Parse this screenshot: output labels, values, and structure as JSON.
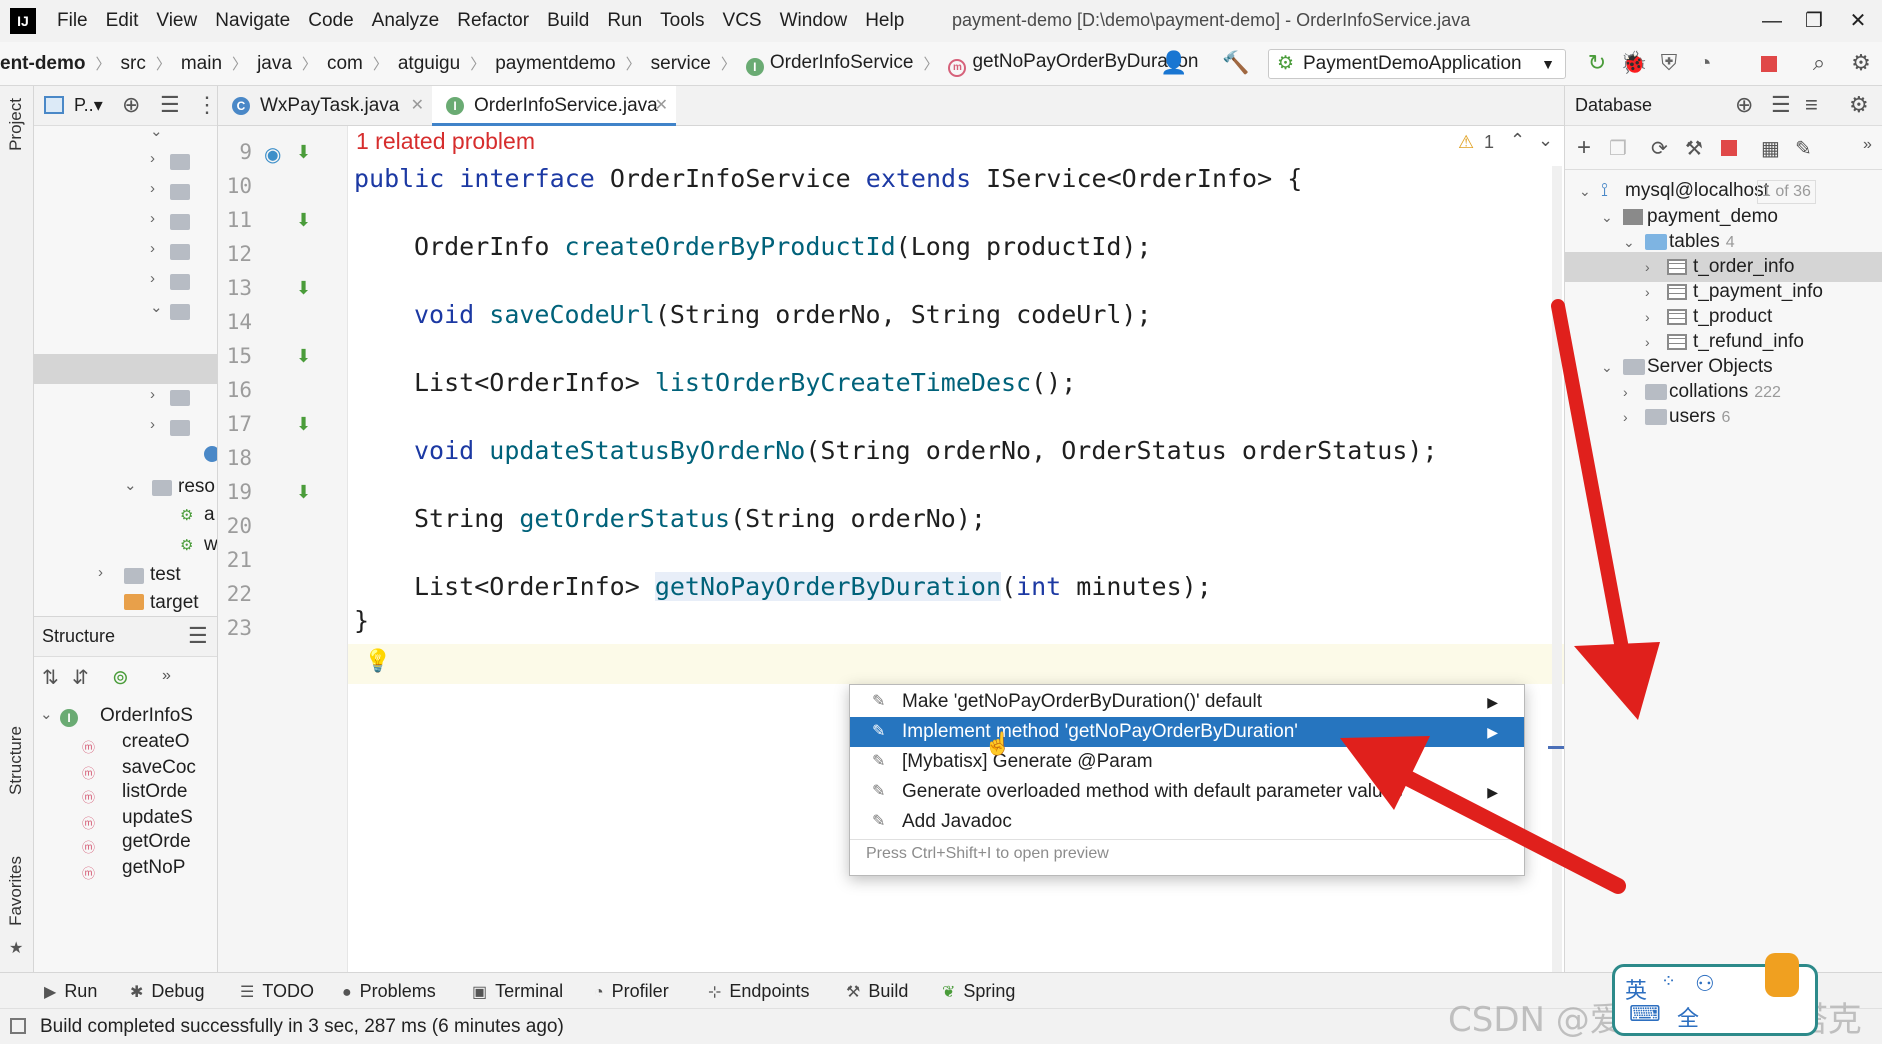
{
  "menubar": {
    "logo": "IJ",
    "items": [
      "File",
      "Edit",
      "View",
      "Navigate",
      "Code",
      "Analyze",
      "Refactor",
      "Build",
      "Run",
      "Tools",
      "VCS",
      "Window",
      "Help"
    ],
    "window_title": "payment-demo [D:\\demo\\payment-demo] - OrderInfoService.java"
  },
  "breadcrumbs": [
    "ent-demo",
    "src",
    "main",
    "java",
    "com",
    "atguigu",
    "paymentdemo",
    "service",
    "OrderInfoService",
    "getNoPayOrderByDuration"
  ],
  "run_config": "PaymentDemoApplication",
  "project_panel": {
    "tab_label": "P..▾",
    "items": [
      "reso",
      "a",
      "w",
      "test",
      "target"
    ]
  },
  "structure_panel": {
    "title": "Structure",
    "root": "OrderInfoS",
    "members": [
      "createO",
      "saveCoc",
      "listOrde",
      "updateS",
      "getOrde",
      "getNoP"
    ]
  },
  "left_strip": {
    "tabs": [
      "Project",
      "Structure",
      "Favorites"
    ]
  },
  "editor": {
    "tabs": [
      {
        "label": "WxPayTask.java",
        "active": false
      },
      {
        "label": "OrderInfoService.java",
        "active": true
      }
    ],
    "related_problem": "1 related problem",
    "warning_count": "1",
    "line_numbers": [
      "9",
      "10",
      "11",
      "12",
      "13",
      "14",
      "15",
      "16",
      "17",
      "18",
      "19",
      "20",
      "21",
      "22",
      "23"
    ],
    "code": {
      "l9_kw1": "public interface",
      "l9_name": " OrderInfoService ",
      "l9_kw2": "extends",
      "l9_rest": " IService<OrderInfo> {",
      "l11_type": "OrderInfo ",
      "l11_fn": "createOrderByProductId",
      "l11_rest": "(Long productId);",
      "l13_kw": "void ",
      "l13_fn": "saveCodeUrl",
      "l13_rest": "(String orderNo, String codeUrl);",
      "l15_type": "List<OrderInfo> ",
      "l15_fn": "listOrderByCreateTimeDesc",
      "l15_rest": "();",
      "l17_kw": "void ",
      "l17_fn": "updateStatusByOrderNo",
      "l17_rest": "(String orderNo, OrderStatus orderStatus);",
      "l19_type": "String ",
      "l19_fn": "getOrderStatus",
      "l19_rest": "(String orderNo);",
      "l21_type": "List<OrderInfo> ",
      "l21_fn": "getNoPayOrderByDuration",
      "l21_p1": "(",
      "l21_kw": "int",
      "l21_rest": " minutes);",
      "l22": "}"
    }
  },
  "intention_popup": {
    "items": [
      {
        "label": "Make 'getNoPayOrderByDuration()' default",
        "has_submenu": true,
        "selected": false
      },
      {
        "label": "Implement method 'getNoPayOrderByDuration'",
        "has_submenu": true,
        "selected": true
      },
      {
        "label": "[Mybatisx] Generate @Param",
        "has_submenu": false,
        "selected": false
      },
      {
        "label": "Generate overloaded method with default parameter values",
        "has_submenu": true,
        "selected": false
      },
      {
        "label": "Add Javadoc",
        "has_submenu": false,
        "selected": false
      }
    ],
    "hint": "Press Ctrl+Shift+I to open preview"
  },
  "database_panel": {
    "title": "Database",
    "connection": "mysql@localhost",
    "connection_count": "1 of 36",
    "schema": "payment_demo",
    "tables_label": "tables",
    "tables_count": "4",
    "tables": [
      "t_order_info",
      "t_payment_info",
      "t_product",
      "t_refund_info"
    ],
    "server_objects": "Server Objects",
    "collations": "collations",
    "collations_count": "222",
    "users": "users",
    "users_count": "6"
  },
  "bottom_tools": [
    "Run",
    "Debug",
    "TODO",
    "Problems",
    "Terminal",
    "Profiler",
    "Endpoints",
    "Build",
    "Spring"
  ],
  "status": "Build completed successfully in 3 sec, 287 ms (6 minutes ago)",
  "watermark": "CSDN @爱你三千遍斯塔克",
  "colors": {
    "selection": "#2675bf",
    "keyword": "#1c39a3",
    "method": "#00627a",
    "annotation_arrow": "#e0201c"
  }
}
